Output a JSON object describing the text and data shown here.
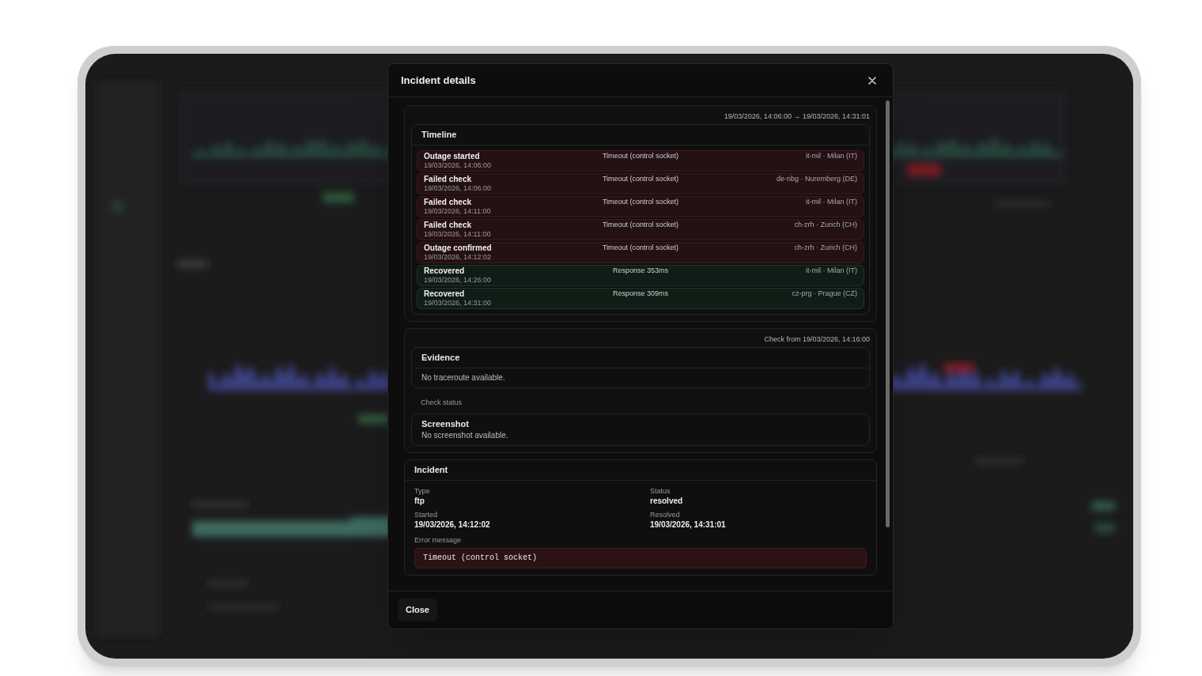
{
  "dialog": {
    "title": "Incident details"
  },
  "timeline_section": {
    "range": "19/03/2026, 14:06:00 → 19/03/2026, 14:31:01",
    "title": "Timeline",
    "events": [
      {
        "kind": "failure",
        "title": "Outage started",
        "time": "19/03/2026, 14:06:00",
        "detail": "Timeout (control socket)",
        "location": "it-mil · Milan (IT)"
      },
      {
        "kind": "failure",
        "title": "Failed check",
        "time": "19/03/2026, 14:06:00",
        "detail": "Timeout (control socket)",
        "location": "de-nbg · Nuremberg (DE)"
      },
      {
        "kind": "failure",
        "title": "Failed check",
        "time": "19/03/2026, 14:11:00",
        "detail": "Timeout (control socket)",
        "location": "it-mil · Milan (IT)"
      },
      {
        "kind": "failure",
        "title": "Failed check",
        "time": "19/03/2026, 14:11:00",
        "detail": "Timeout (control socket)",
        "location": "ch-zrh · Zurich (CH)"
      },
      {
        "kind": "failure",
        "title": "Outage confirmed",
        "time": "19/03/2026, 14:12:02",
        "detail": "Timeout (control socket)",
        "location": "ch-zrh · Zurich (CH)"
      },
      {
        "kind": "recovery",
        "title": "Recovered",
        "time": "19/03/2026, 14:26:00",
        "detail": "Response 353ms",
        "location": "it-mil · Milan (IT)"
      },
      {
        "kind": "recovery",
        "title": "Recovered",
        "time": "19/03/2026, 14:31:00",
        "detail": "Response 309ms",
        "location": "cz-prg · Prague (CZ)"
      }
    ]
  },
  "evidence_section": {
    "check_from": "Check from 19/03/2026, 14:16:00",
    "title": "Evidence",
    "traceroute": "No traceroute available.",
    "check_status_label": "Check status",
    "screenshot": {
      "title": "Screenshot",
      "message": "No screenshot available."
    }
  },
  "incident_section": {
    "title": "Incident",
    "fields": [
      {
        "label": "Type",
        "value": "ftp"
      },
      {
        "label": "Status",
        "value": "resolved"
      },
      {
        "label": "Started",
        "value": "19/03/2026, 14:12:02"
      },
      {
        "label": "Resolved",
        "value": "19/03/2026, 14:31:01"
      }
    ],
    "error": {
      "label": "Error message",
      "message": "Timeout (control socket)"
    }
  },
  "footer": {
    "close_button": "Close"
  }
}
